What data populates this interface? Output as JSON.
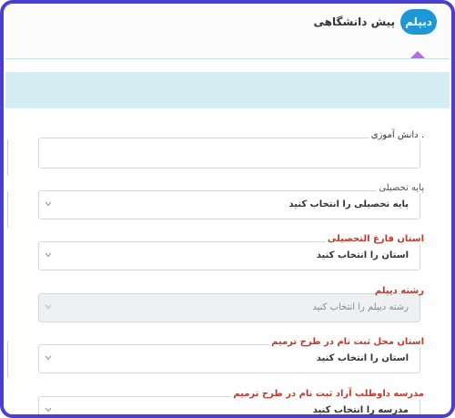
{
  "header": {
    "tab_diploma": "دیپلم",
    "tab_preuniversity": "پیش دانشگاهی"
  },
  "colors": {
    "frame": "#4a3fd0",
    "tab_active": "#1e97d6",
    "arrow": "#b66be8",
    "panel_header": "#d4eef3",
    "required_label": "#c0392b"
  },
  "form": {
    "school_field": {
      "label": ". دانش آموزی",
      "value": ""
    },
    "grade": {
      "label": "پایه تحصیلی",
      "value": "پایه تحصیلی را انتخاب کنید"
    },
    "grad_province": {
      "label": "استان فارغ التحصیلی",
      "value": "استان را انتخاب کنید"
    },
    "diploma_major": {
      "label": "رشته دیپلم",
      "value": "رشته دیپلم را انتخاب کنید"
    },
    "reg_province": {
      "label": "استان محل ثبت نام در طرح ترمیم",
      "value": "استان را انتخاب کنید"
    },
    "volunteer_school": {
      "label": "مدرسه داوطلب آزاد ثبت نام در طرح ترمیم",
      "value": "مدرسه را انتخاب کنید"
    }
  }
}
